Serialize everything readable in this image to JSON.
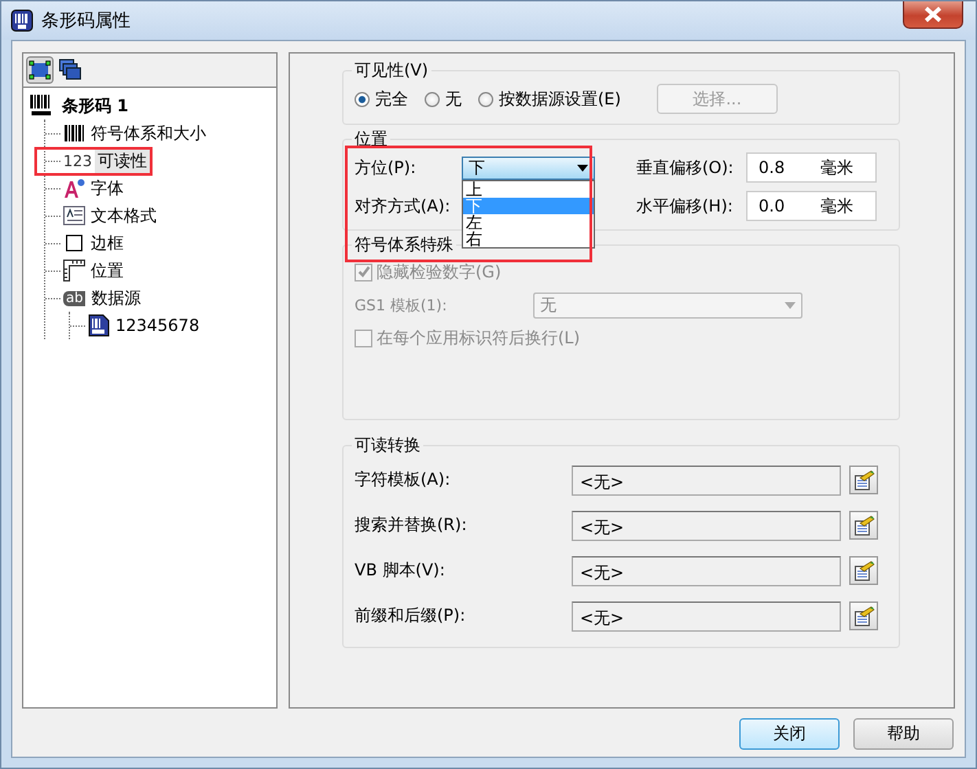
{
  "window": {
    "title": "条形码属性"
  },
  "tree": {
    "label": "条形码 1",
    "selected": false,
    "highlighted": false,
    "children": [
      {
        "kind": "symbology",
        "label": "符号体系和大小",
        "selected": false,
        "highlighted": false
      },
      {
        "kind": "readability",
        "icon_text": "123",
        "label": "可读性",
        "selected": true,
        "highlighted": true
      },
      {
        "kind": "font",
        "label": "字体",
        "selected": false,
        "highlighted": false
      },
      {
        "kind": "text-format",
        "label": "文本格式",
        "selected": false,
        "highlighted": false
      },
      {
        "kind": "border",
        "label": "边框",
        "selected": false,
        "highlighted": false
      },
      {
        "kind": "position",
        "label": "位置",
        "selected": false,
        "highlighted": false
      },
      {
        "kind": "data-source",
        "icon_text": "ab",
        "label": "数据源",
        "selected": false,
        "highlighted": false,
        "children": [
          {
            "kind": "data-item",
            "label": "12345678",
            "selected": false,
            "highlighted": false
          }
        ]
      }
    ]
  },
  "visibility": {
    "label": "可见性(V)",
    "options": [
      {
        "label": "完全",
        "selected": true
      },
      {
        "label": "无",
        "selected": false
      },
      {
        "label": "按数据源设置(E)",
        "selected": false
      }
    ],
    "select_button": {
      "label": "选择...",
      "disabled": true
    }
  },
  "position": {
    "label": "位置",
    "highlighted": true,
    "orientation": {
      "label": "方位(P):",
      "value": "下",
      "expanded": true,
      "options": [
        {
          "label": "上",
          "selected": false
        },
        {
          "label": "下",
          "selected": true
        },
        {
          "label": "左",
          "selected": false
        },
        {
          "label": "右",
          "selected": false
        }
      ]
    },
    "alignment": {
      "label": "对齐方式(A):"
    },
    "vertical_offset": {
      "label": "垂直偏移(O):",
      "value": "0.8",
      "unit": "毫米"
    },
    "horizontal_offset": {
      "label": "水平偏移(H):",
      "value": "0.0",
      "unit": "毫米"
    }
  },
  "symbology_options": {
    "label": "符号体系特殊",
    "hide_check_digit": {
      "label": "隐藏检验数字(G)",
      "checked": true,
      "disabled": true
    },
    "gs1_template": {
      "label": "GS1 模板(1):",
      "value": "无",
      "disabled": true
    },
    "line_break": {
      "label": "在每个应用标识符后换行(L)",
      "checked": false,
      "disabled": true
    }
  },
  "readable_conversion": {
    "label": "可读转换",
    "rows": [
      {
        "label": "字符模板(A):",
        "value": "<无>"
      },
      {
        "label": "搜索并替换(R):",
        "value": "<无>"
      },
      {
        "label": "VB 脚本(V):",
        "value": "<无>"
      },
      {
        "label": "前缀和后缀(P):",
        "value": "<无>"
      }
    ]
  },
  "buttons": [
    {
      "label": "关闭",
      "default": true
    },
    {
      "label": "帮助",
      "default": false
    }
  ]
}
